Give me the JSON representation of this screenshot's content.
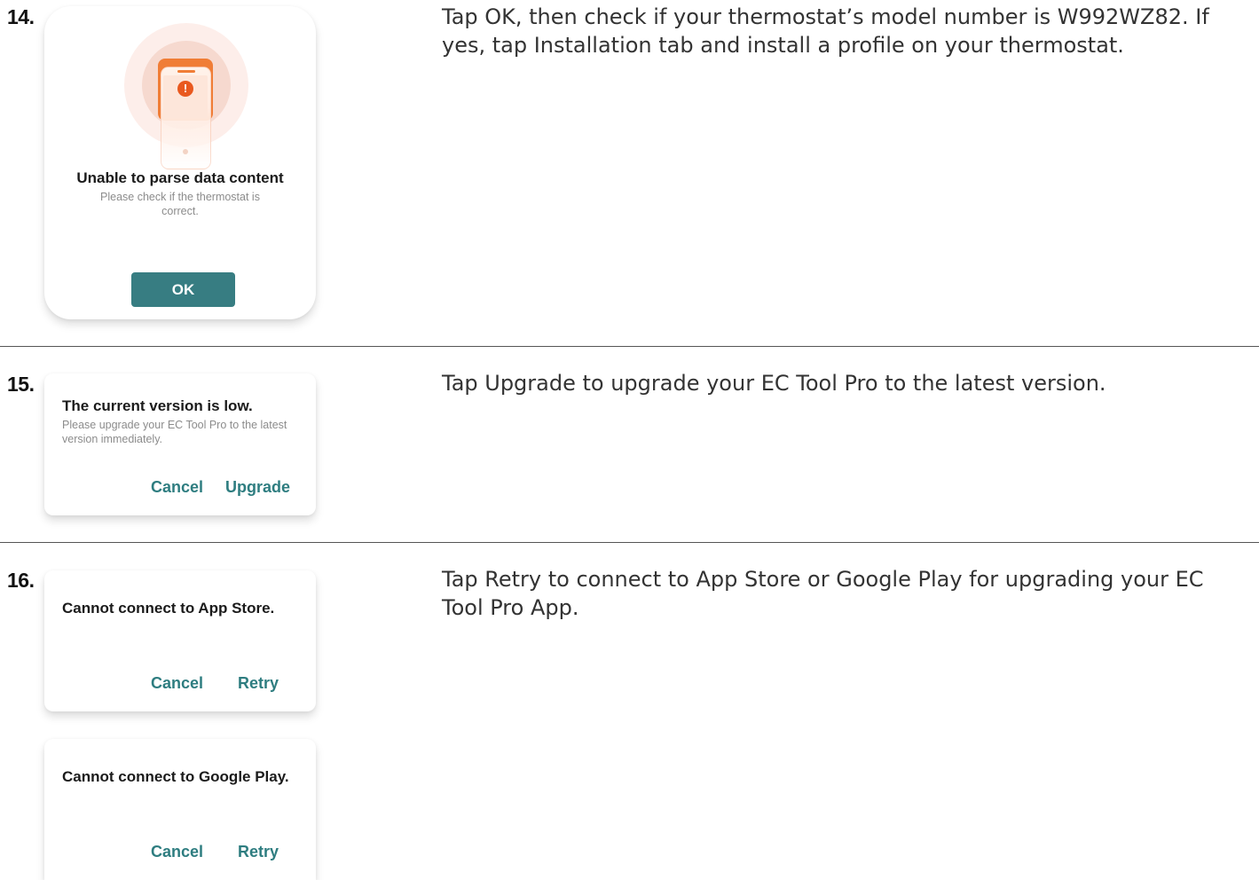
{
  "steps": [
    {
      "number": "14.",
      "instruction": "Tap OK, then check if your thermostat’s model number is W992WZ82. If yes, tap Installation tab and install a profile on your thermostat.",
      "dialog": {
        "title": "Unable to parse data content",
        "message": "Please check if the thermostat is correct.",
        "button": "OK",
        "icon": "phone-alert-icon"
      }
    },
    {
      "number": "15.",
      "instruction": "Tap Upgrade to upgrade your EC Tool Pro to the latest version.",
      "dialog": {
        "title": "The current version is low.",
        "message": "Please upgrade your EC Tool Pro to the latest version immediately.",
        "cancel": "Cancel",
        "confirm": "Upgrade"
      }
    },
    {
      "number": "16.",
      "instruction": "Tap Retry to connect to App Store or Google Play for upgrading your EC Tool Pro App.",
      "dialogs": [
        {
          "title": "Cannot connect to App Store.",
          "cancel": "Cancel",
          "confirm": "Retry"
        },
        {
          "title": "Cannot connect to Google Play.",
          "cancel": "Cancel",
          "confirm": "Retry"
        }
      ]
    }
  ],
  "colors": {
    "accent": "#377d82",
    "accent_text": "#2e7d80",
    "alert_orange": "#f07d36"
  }
}
